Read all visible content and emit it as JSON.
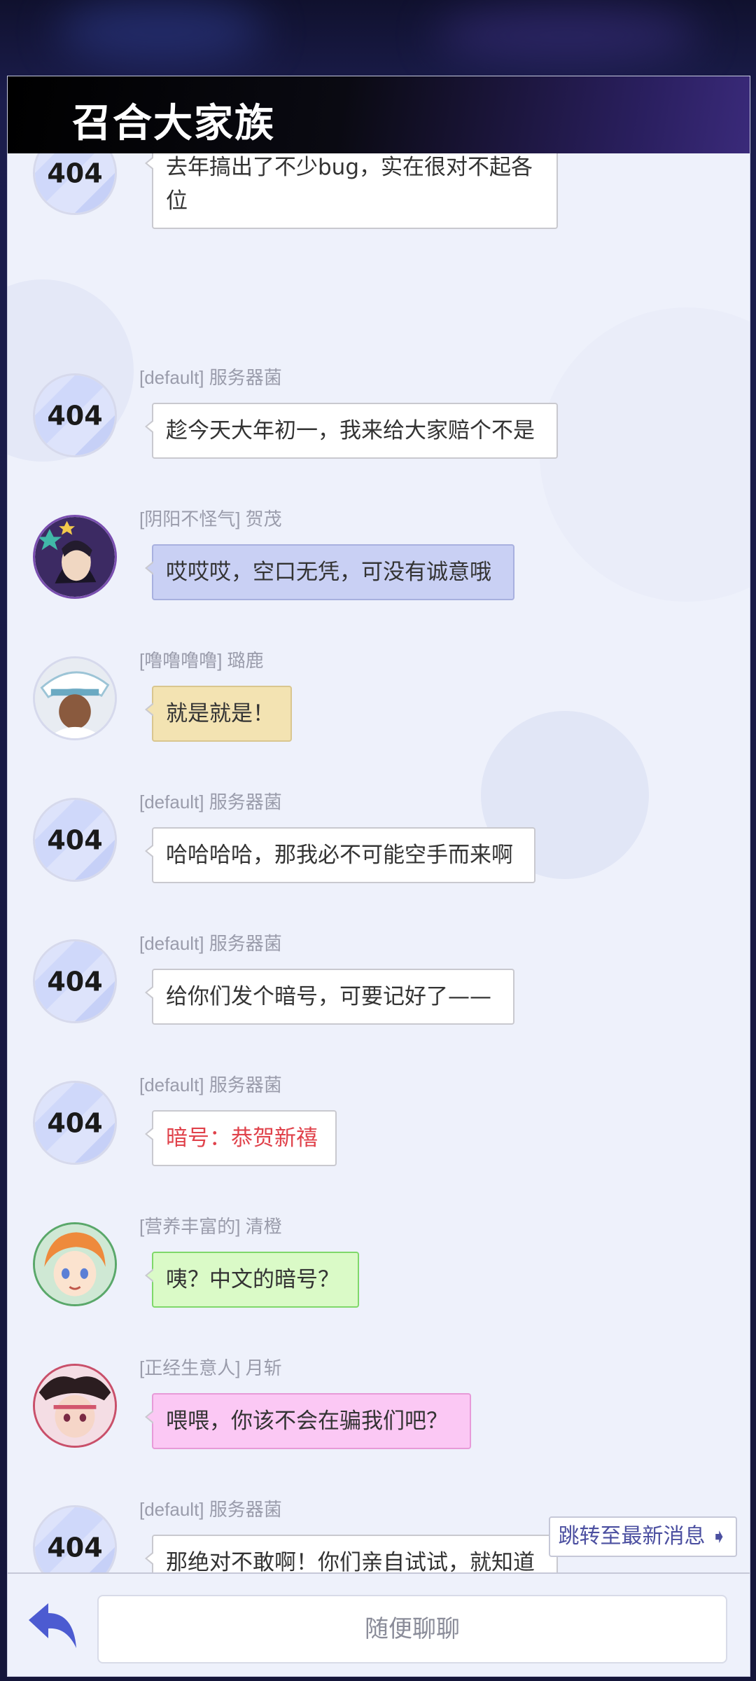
{
  "window": {
    "title": "召合大家族"
  },
  "messages": [
    {
      "sender": "",
      "text": "去年搞出了不少bug，实在很对不起各位",
      "style": "white",
      "avatar": "404"
    },
    {
      "sender": "[default] 服务器菌",
      "text": "趁今天大年初一，我来给大家赔个不是",
      "style": "white",
      "avatar": "404"
    },
    {
      "sender": "[阴阳不怪气] 贺茂",
      "text": "哎哎哎，空口无凭，可没有诚意哦",
      "style": "blue",
      "avatar": "hemao"
    },
    {
      "sender": "[噜噜噜噜] 璐鹿",
      "text": "就是就是！",
      "style": "yellow",
      "avatar": "lulu"
    },
    {
      "sender": "[default] 服务器菌",
      "text": "哈哈哈哈，那我必不可能空手而来啊",
      "style": "white",
      "avatar": "404"
    },
    {
      "sender": "[default] 服务器菌",
      "text": "给你们发个暗号，可要记好了——",
      "style": "white",
      "avatar": "404"
    },
    {
      "sender": "[default] 服务器菌",
      "text": "暗号：恭贺新禧",
      "style": "red",
      "avatar": "404"
    },
    {
      "sender": "[营养丰富的] 清橙",
      "text": "咦？中文的暗号？",
      "style": "green",
      "avatar": "qingcheng"
    },
    {
      "sender": "[正经生意人] 月斩",
      "text": "喂喂，你该不会在骗我们吧？",
      "style": "pink",
      "avatar": "yuezhan"
    },
    {
      "sender": "[default] 服务器菌",
      "text": "那绝对不敢啊！你们亲自试试，就知道了！",
      "style": "white",
      "avatar": "404"
    }
  ],
  "avatar_label": "404",
  "jump_button": {
    "label": "跳转至最新消息"
  },
  "input": {
    "placeholder": "随便聊聊"
  },
  "icons": {
    "back": "back-arrow-icon",
    "jump": "chevron-right-icon"
  },
  "colors": {
    "accent": "#4b4fa0",
    "header_bg": "#000000",
    "panel_bg": "#eef1fb",
    "red_text": "#e0424b"
  }
}
